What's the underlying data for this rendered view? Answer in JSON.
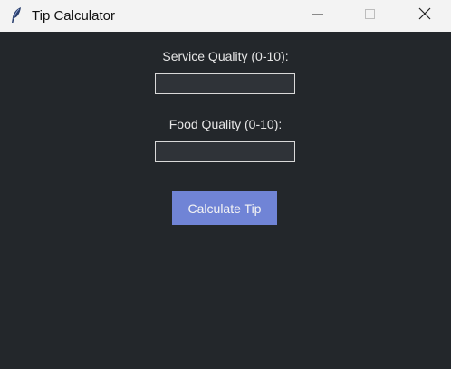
{
  "window": {
    "title": "Tip Calculator",
    "icon": "feather-icon",
    "controls": {
      "minimize": "minimize-icon",
      "maximize": "maximize-icon",
      "close": "close-icon"
    }
  },
  "form": {
    "service_label": "Service Quality (0-10):",
    "service_value": "",
    "food_label": "Food Quality (0-10):",
    "food_value": "",
    "calculate_label": "Calculate Tip"
  },
  "colors": {
    "background": "#23272b",
    "titlebar": "#f3f3f3",
    "button": "#7084d6",
    "text": "#e6e6e6"
  }
}
